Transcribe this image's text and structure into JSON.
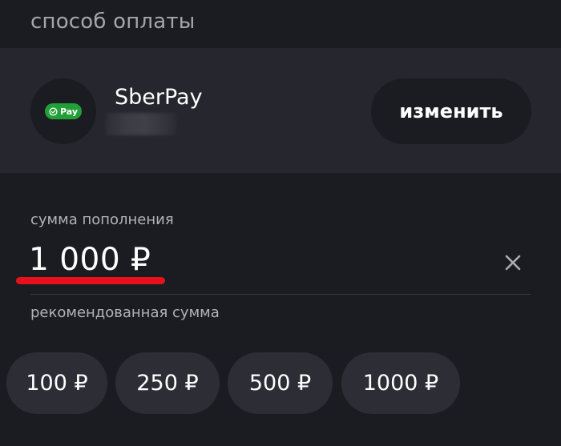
{
  "section": {
    "title": "способ оплаты"
  },
  "payment_method": {
    "badge_label": "Pay",
    "name": "SberPay",
    "icon": "sberpay-check-icon",
    "brand_color": "#21a038",
    "change_label": "изменить"
  },
  "amount": {
    "label": "сумма пополнения",
    "value": "1 000 ₽",
    "highlight_color": "#e8111b",
    "clear_icon": "close-icon"
  },
  "recommended": {
    "label": "рекомендованная сумма",
    "options": [
      "100 ₽",
      "250 ₽",
      "500 ₽",
      "1000 ₽"
    ]
  },
  "colors": {
    "background": "#1b1c21",
    "card": "#26272e",
    "chip": "#2c2d35",
    "muted_text": "#a4a6ac"
  }
}
